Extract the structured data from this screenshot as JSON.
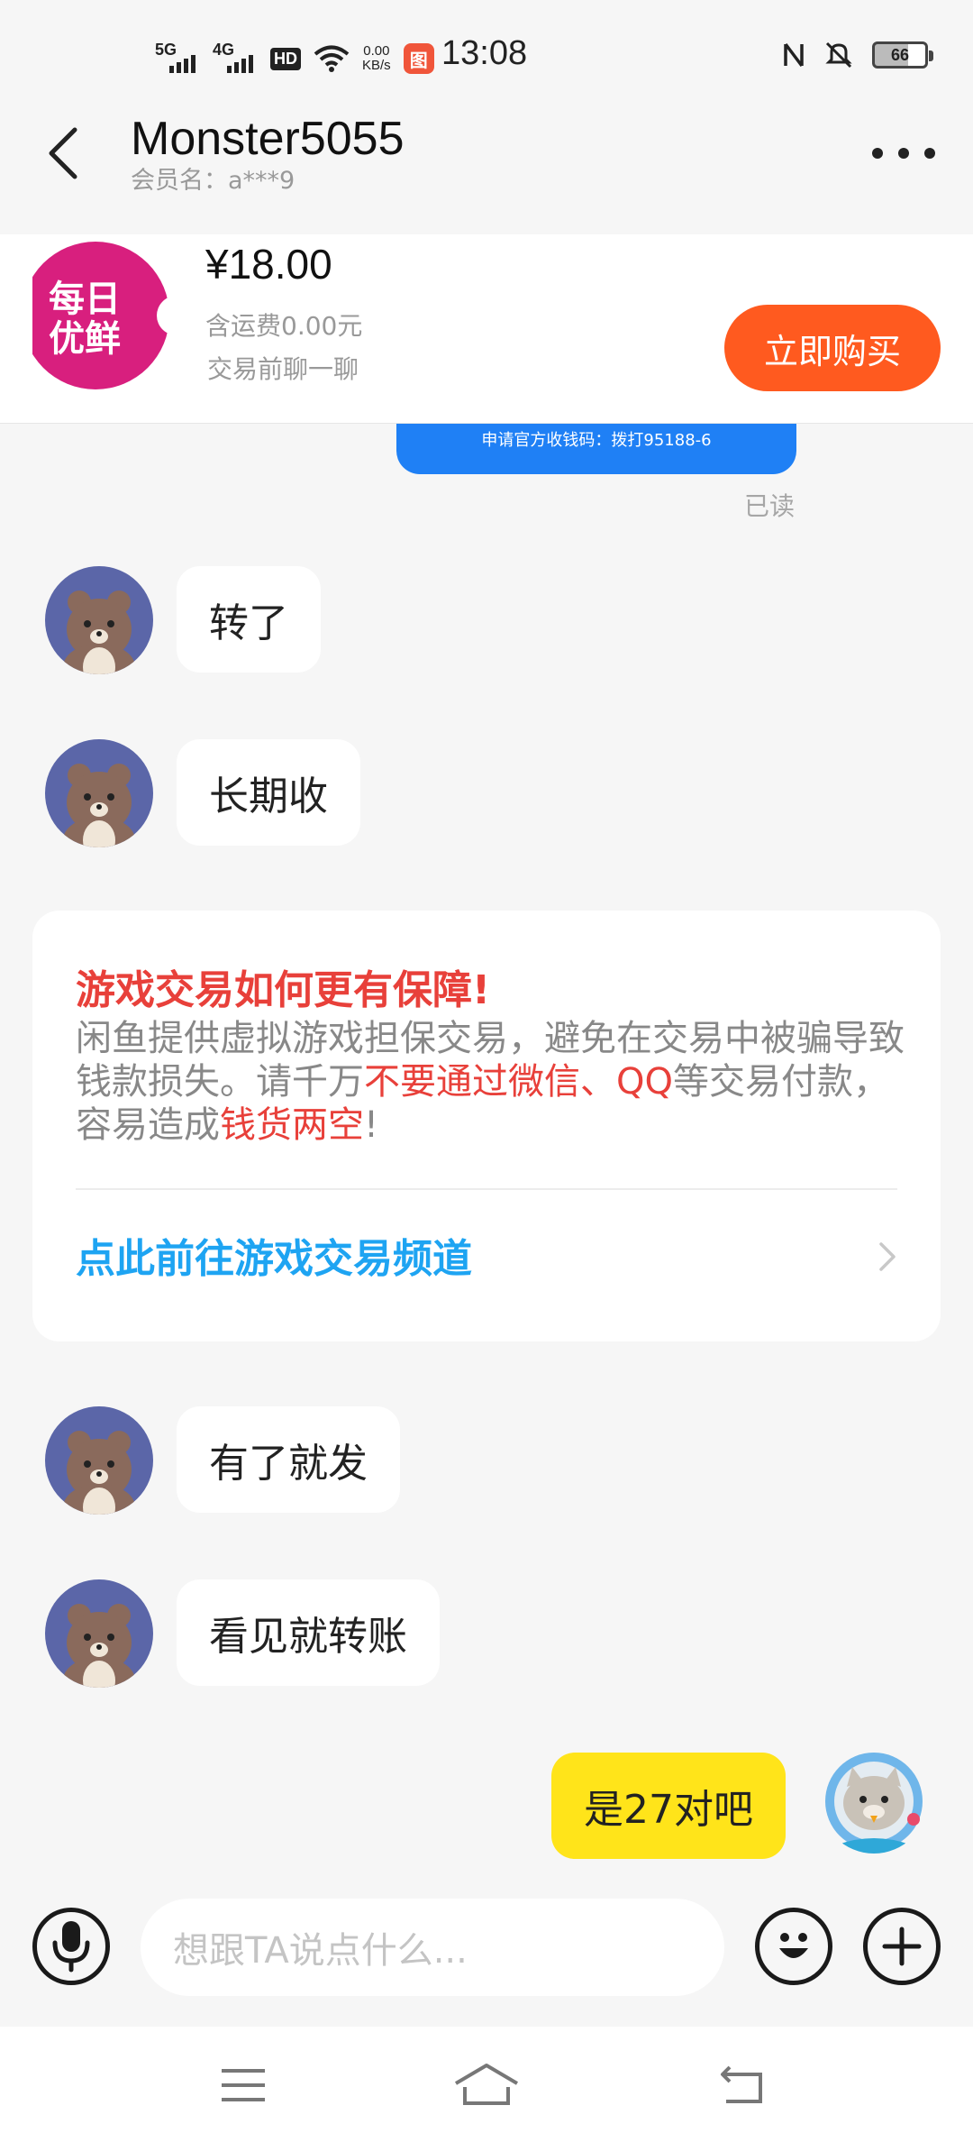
{
  "status_bar": {
    "sig1": "5G",
    "sig2": "4G",
    "hd": "HD",
    "speed_value": "0.00",
    "speed_unit": "KB/s",
    "app_icon_text": "图",
    "time": "13:08",
    "battery": "66",
    "icons": [
      "nfc-icon",
      "mute-icon",
      "battery-icon",
      "wifi-icon"
    ]
  },
  "header": {
    "title": "Monster5055",
    "subtitle": "会员名：a***9"
  },
  "product": {
    "thumb_line1": "每日",
    "thumb_line2": "优鲜",
    "price": "¥18.00",
    "shipping": "含运费0.00元",
    "chat_hint": "交易前聊一聊",
    "buy_label": "立即购买"
  },
  "chat": {
    "truncated_text": "申请官方收钱码：拨打95188-6",
    "read_label": "已读",
    "messages_top": [
      "转了",
      "长期收"
    ],
    "notice": {
      "title": "游戏交易如何更有保障!",
      "body_part1": "闲鱼提供虚拟游戏担保交易，避免在交易中被骗导致钱款损失。请千万",
      "body_red1": "不要通过微信、QQ",
      "body_part2": "等交易付款，容易造成",
      "body_red2": "钱货两空",
      "body_part3": "!",
      "link": "点此前往游戏交易频道"
    },
    "messages_bottom": [
      "有了就发",
      "看见就转账"
    ],
    "my_message": "是27对吧"
  },
  "input": {
    "placeholder": "想跟TA说点什么..."
  },
  "colors": {
    "accent": "#ff5a1f",
    "notice_red": "#e8403a",
    "link_blue": "#1ea4f2",
    "my_bubble": "#ffe41a",
    "avatar_bg": "#5b66a8",
    "thumb_bg": "#d81f7e"
  }
}
